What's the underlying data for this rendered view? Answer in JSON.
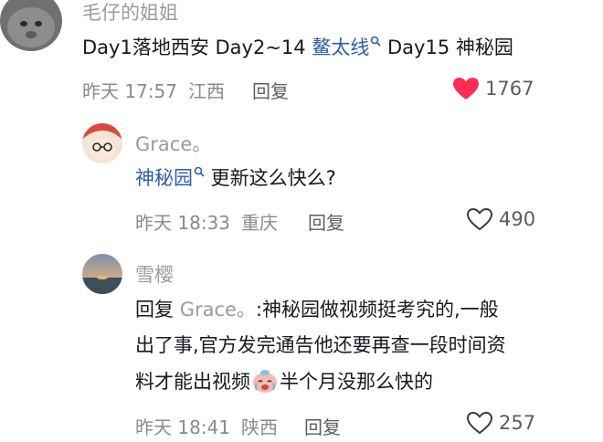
{
  "comments": [
    {
      "username": "毛仔的姐姐",
      "content_prefix": "Day1落地西安 Day2~14 ",
      "link": "鳌太线",
      "content_suffix": " Day15 神秘园",
      "time": "昨天 17:57",
      "location": "江西",
      "reply_label": "回复",
      "likes": "1767",
      "liked": true
    },
    {
      "username": "Grace。",
      "link": "神秘园",
      "content_suffix": " 更新这么快么?",
      "time": "昨天 18:33",
      "location": "重庆",
      "reply_label": "回复",
      "likes": "490",
      "liked": false
    },
    {
      "username": "雪樱",
      "reply_prefix": "回复",
      "reply_target": "Grace。",
      "line1": ":神秘园做视频挺考究的,一般",
      "line2": "出了事,官方发完通告他还要再查一段时间资",
      "line3_prefix": "料才能出视频",
      "line3_suffix": "半个月没那么快的",
      "emoji": "crying-face",
      "time": "昨天 18:41",
      "location": "陕西",
      "reply_label": "回复",
      "likes": "257",
      "liked": false
    }
  ],
  "colors": {
    "link": "#2f5cad",
    "like_active": "#fe2c55",
    "meta": "#8a8a90",
    "username": "#9a9aa0"
  }
}
